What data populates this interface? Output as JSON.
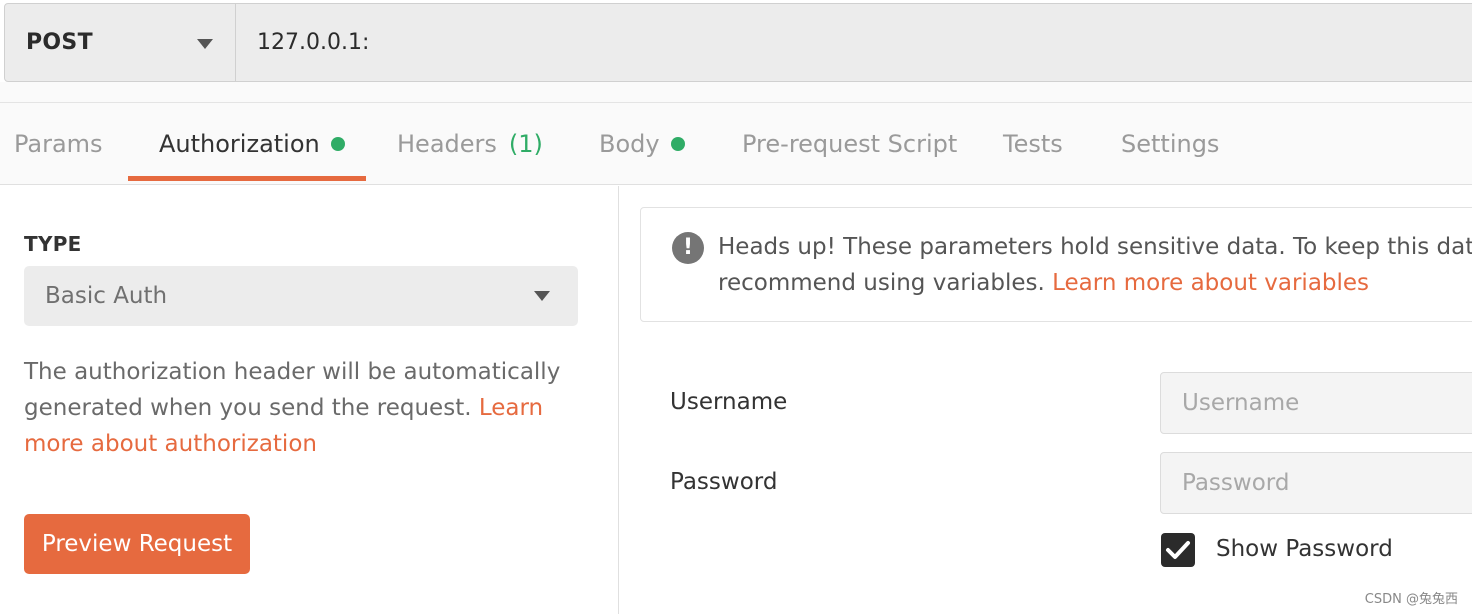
{
  "request": {
    "method": "POST",
    "url": "127.0.0.1:"
  },
  "tabs": [
    {
      "label": "Params",
      "active": false
    },
    {
      "label": "Authorization",
      "active": true,
      "indicator": "dot"
    },
    {
      "label": "Headers",
      "count": "(1)",
      "active": false
    },
    {
      "label": "Body",
      "active": false,
      "indicator": "dot"
    },
    {
      "label": "Pre-request Script",
      "active": false
    },
    {
      "label": "Tests",
      "active": false
    },
    {
      "label": "Settings",
      "active": false
    }
  ],
  "auth": {
    "type_heading": "TYPE",
    "type_value": "Basic Auth",
    "help_text": "The authorization header will be automatically generated when you send the request.",
    "help_link": "Learn more about authorization",
    "preview_button": "Preview Request"
  },
  "alert": {
    "icon": "exclamation-circle-icon",
    "text_line1": "Heads up! These parameters hold sensitive data. To keep this data s",
    "text_line2": "recommend using variables.",
    "link": "Learn more about variables"
  },
  "form": {
    "username_label": "Username",
    "username_placeholder": "Username",
    "password_label": "Password",
    "password_placeholder": "Password",
    "show_password_label": "Show Password",
    "show_password_checked": true
  },
  "watermark": "CSDN @兔兔西",
  "colors": {
    "accent": "#e66a3f",
    "indicator_green": "#2fac66",
    "button_text": "#ffffff"
  }
}
